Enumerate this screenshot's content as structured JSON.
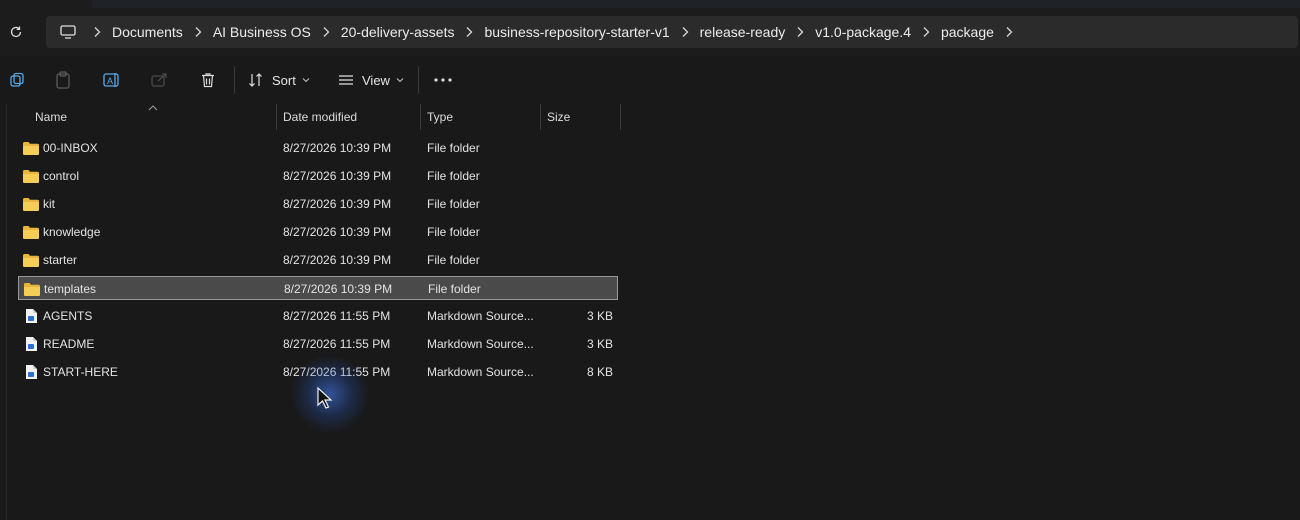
{
  "window": {
    "accent_color": "#4a4a4a",
    "background": "#191919"
  },
  "address_bar": {
    "refresh_icon": "refresh-icon",
    "root_icon": "this-pc-icon",
    "breadcrumbs": [
      "Documents",
      "AI Business OS",
      "20-delivery-assets",
      "business-repository-starter-v1",
      "release-ready",
      "v1.0-package.4",
      "package"
    ]
  },
  "toolbar": {
    "icons": [
      "new-item-icon",
      "paste-icon",
      "rename-icon",
      "share-icon",
      "delete-icon"
    ],
    "sort_label": "Sort",
    "view_label": "View",
    "more_label": "..."
  },
  "columns": {
    "name": "Name",
    "date_modified": "Date modified",
    "type": "Type",
    "size": "Size"
  },
  "files": [
    {
      "name": "00-INBOX",
      "date": "8/27/2026 10:39 PM",
      "type": "File folder",
      "size": "",
      "icon": "folder-icon"
    },
    {
      "name": "control",
      "date": "8/27/2026 10:39 PM",
      "type": "File folder",
      "size": "",
      "icon": "folder-icon"
    },
    {
      "name": "kit",
      "date": "8/27/2026 10:39 PM",
      "type": "File folder",
      "size": "",
      "icon": "folder-icon"
    },
    {
      "name": "knowledge",
      "date": "8/27/2026 10:39 PM",
      "type": "File folder",
      "size": "",
      "icon": "folder-icon"
    },
    {
      "name": "starter",
      "date": "8/27/2026 10:39 PM",
      "type": "File folder",
      "size": "",
      "icon": "folder-icon"
    },
    {
      "name": "templates",
      "date": "8/27/2026 10:39 PM",
      "type": "File folder",
      "size": "",
      "icon": "folder-icon",
      "selected": true
    },
    {
      "name": "AGENTS",
      "date": "8/27/2026 11:55 PM",
      "type": "Markdown Source...",
      "size": "3 KB",
      "icon": "markdown-file-icon"
    },
    {
      "name": "README",
      "date": "8/27/2026 11:55 PM",
      "type": "Markdown Source...",
      "size": "3 KB",
      "icon": "markdown-file-icon"
    },
    {
      "name": "START-HERE",
      "date": "8/27/2026 11:55 PM",
      "type": "Markdown Source...",
      "size": "8 KB",
      "icon": "markdown-file-icon"
    }
  ]
}
